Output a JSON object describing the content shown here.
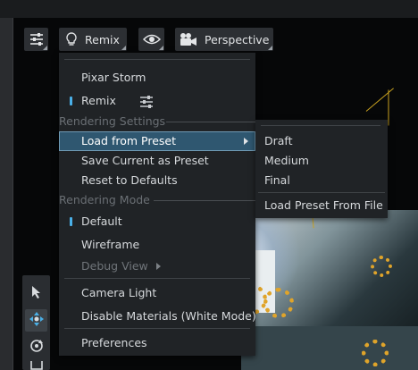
{
  "toolbar": {
    "settings_icon": "sliders-icon",
    "renderer_icon": "lightbulb-icon",
    "renderer_label": "Remix",
    "visibility_icon": "eye-icon",
    "camera_icon": "camera-icon",
    "camera_label": "Perspective"
  },
  "menu": {
    "items": [
      {
        "label": "Pixar Storm"
      },
      {
        "label": "Remix",
        "checked": true,
        "icon": "sliders-icon"
      }
    ],
    "rendering_settings_label": "Rendering Settings",
    "load_from_preset": "Load from Preset",
    "save_current_as_preset": "Save Current as Preset",
    "reset_to_defaults": "Reset to Defaults",
    "rendering_mode_label": "Rendering Mode",
    "mode_default": "Default",
    "mode_wireframe": "Wireframe",
    "debug_view": "Debug View",
    "camera_light": "Camera Light",
    "disable_materials": "Disable Materials (White Mode)",
    "preferences": "Preferences"
  },
  "submenu": {
    "draft": "Draft",
    "medium": "Medium",
    "final": "Final",
    "load_preset_from_file": "Load Preset From File"
  },
  "tools": [
    "cursor-icon",
    "move-icon",
    "rotate-icon",
    "scale-icon"
  ],
  "colors": {
    "accent": "#4ab0e8",
    "highlight": "#2f5770",
    "menu_bg": "#202326"
  }
}
